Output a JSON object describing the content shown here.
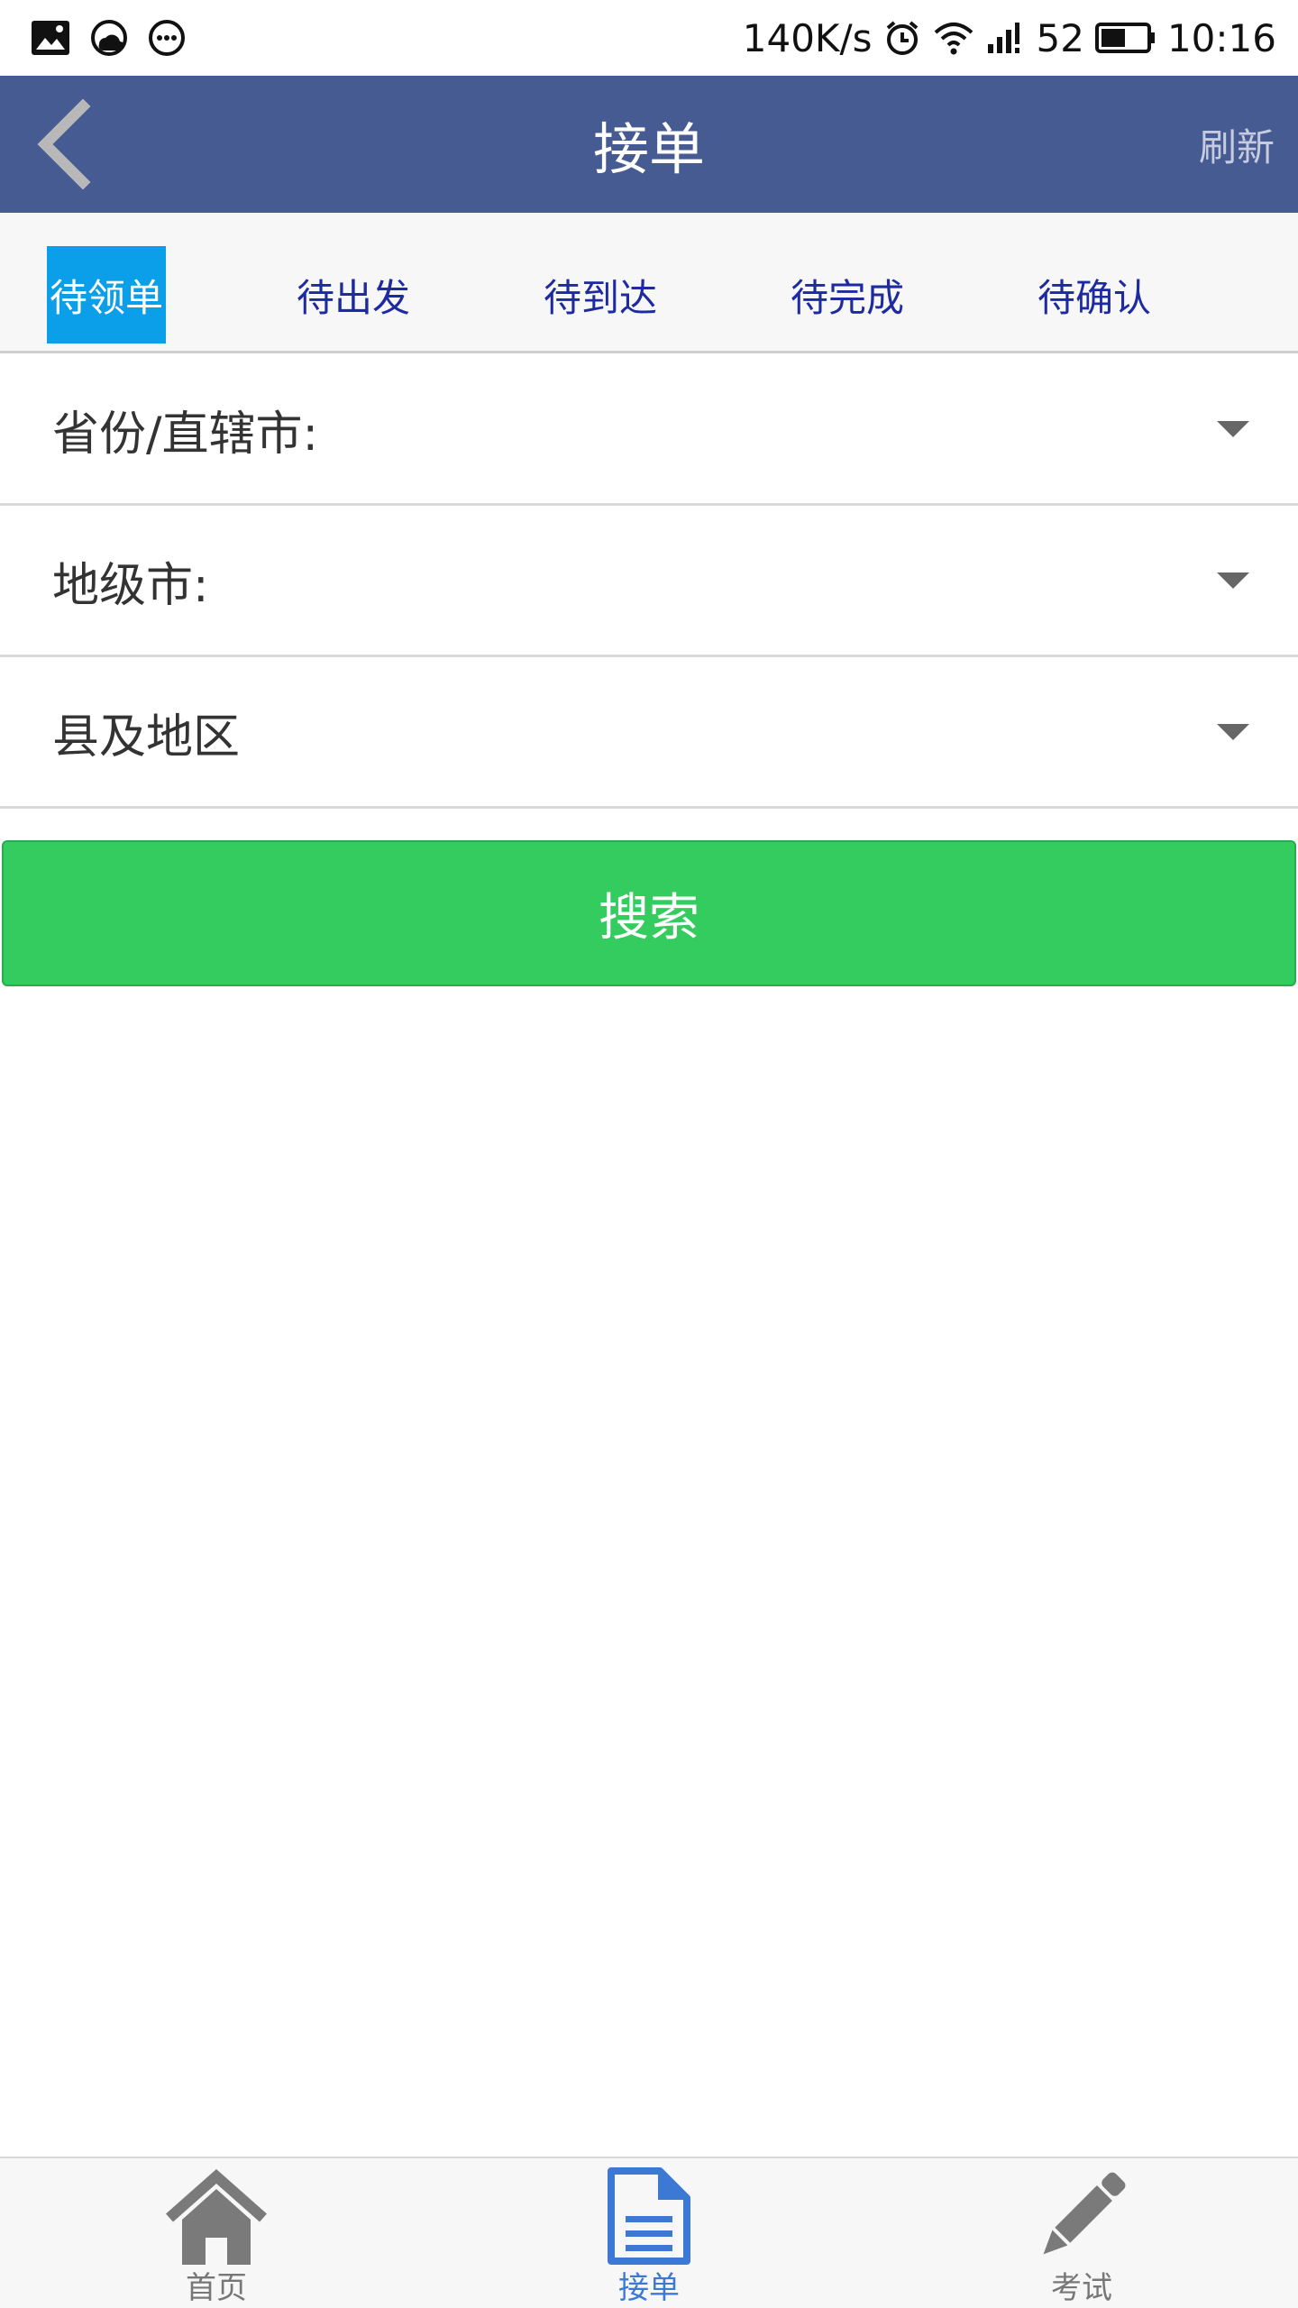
{
  "status_bar": {
    "network_speed": "140K/s",
    "battery_level": "52",
    "time": "10:16",
    "left_icons": [
      "image-icon",
      "weather-icon",
      "more-dots-icon"
    ],
    "right_icons": [
      "alarm-icon",
      "wifi-icon",
      "signal-icon",
      "battery-icon"
    ]
  },
  "app_bar": {
    "title": "接单",
    "back_icon": "chevron-left-icon",
    "refresh_label": "刷新"
  },
  "tabs": [
    {
      "label": "待领单",
      "active": true
    },
    {
      "label": "待出发",
      "active": false
    },
    {
      "label": "待到达",
      "active": false
    },
    {
      "label": "待完成",
      "active": false
    },
    {
      "label": "待确认",
      "active": false
    }
  ],
  "filters": [
    {
      "label": "省份/直辖市:",
      "icon": "caret-down-icon"
    },
    {
      "label": "地级市:",
      "icon": "caret-down-icon"
    },
    {
      "label": "县及地区",
      "icon": "caret-down-icon"
    }
  ],
  "search": {
    "label": "搜索"
  },
  "bottom_nav": [
    {
      "label": "首页",
      "icon": "home-icon",
      "active": false
    },
    {
      "label": "接单",
      "icon": "document-icon",
      "active": true
    },
    {
      "label": "考试",
      "icon": "pencil-icon",
      "active": false
    }
  ],
  "colors": {
    "app_bar": "#455b92",
    "active_tab": "#0a9fe8",
    "tab_text": "#1d2aa0",
    "search_button": "#35cc5f",
    "nav_active": "#3c79d4",
    "nav_inactive": "#777777"
  }
}
